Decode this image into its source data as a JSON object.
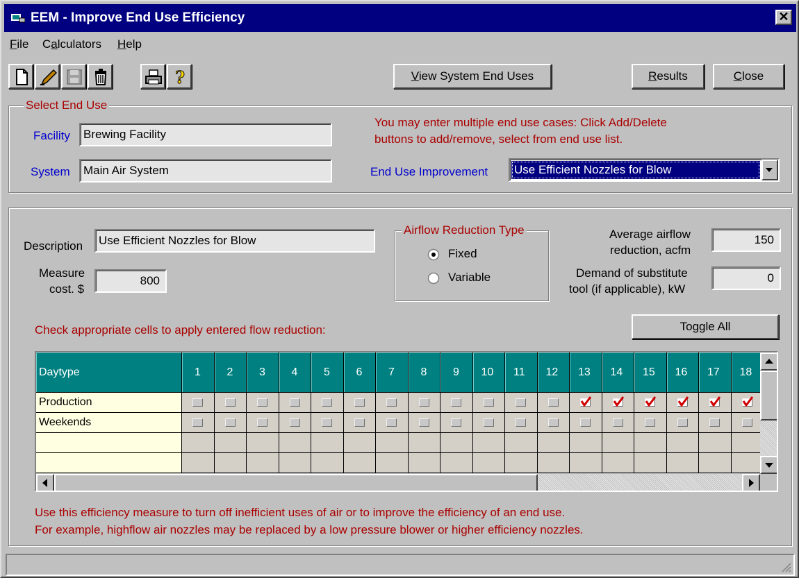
{
  "window": {
    "title": "EEM - Improve End Use Efficiency",
    "close_glyph": "✕"
  },
  "menu": [
    {
      "label": "File",
      "key": "F"
    },
    {
      "label": "Calculators",
      "key": "a"
    },
    {
      "label": "Help",
      "key": "H"
    }
  ],
  "toolbar": {
    "icons": [
      "new-icon",
      "edit-icon",
      "save-icon",
      "delete-icon",
      "print-icon",
      "help-icon"
    ]
  },
  "buttons": {
    "view_end_uses": "View System End Uses",
    "results": "Results",
    "close": "Close",
    "toggle_all": "Toggle All"
  },
  "select_end_use": {
    "legend": "Select End Use",
    "facility_label": "Facility",
    "facility_value": "Brewing Facility",
    "system_label": "System",
    "system_value": "Main Air System",
    "info_line1": "You may enter multiple end use cases: Click Add/Delete",
    "info_line2": "buttons to add/remove, select from end use list.",
    "improvement_label": "End Use Improvement",
    "improvement_value": "Use Efficient Nozzles for Blow"
  },
  "details": {
    "description_label": "Description",
    "description_value": "Use Efficient Nozzles for Blow",
    "measure_label_1": "Measure",
    "measure_label_2": "cost. $",
    "measure_value": "800",
    "airflow_legend": "Airflow Reduction Type",
    "fixed_label": "Fixed",
    "variable_label": "Variable",
    "selected_type": "Fixed",
    "avg_label_1": "Average airflow",
    "avg_label_2": "reduction, acfm",
    "avg_value": "150",
    "demand_label_1": "Demand of substitute",
    "demand_label_2": "tool (if applicable), kW",
    "demand_value": "0",
    "check_instruction": "Check appropriate cells to apply entered flow reduction:"
  },
  "grid": {
    "header_label": "Daytype",
    "hours": [
      "1",
      "2",
      "3",
      "4",
      "5",
      "6",
      "7",
      "8",
      "9",
      "10",
      "11",
      "12",
      "13",
      "14",
      "15",
      "16",
      "17",
      "18"
    ],
    "rows": [
      {
        "label": "Production",
        "checked": [
          13,
          14,
          15,
          16,
          17,
          18
        ]
      },
      {
        "label": "Weekends",
        "checked": []
      },
      {
        "label": "",
        "checked": null
      },
      {
        "label": "",
        "checked": null
      }
    ]
  },
  "footer": {
    "line1": "Use this efficiency measure to turn off inefficient uses of air or to improve the efficiency of an end use.",
    "line2": "For example, highflow air nozzles may be replaced by a low pressure blower or higher efficiency nozzles."
  },
  "colors": {
    "title_bar": "#000080",
    "grid_header": "#008080",
    "row_label_bg": "#ffffe1",
    "info_text": "#aa0000",
    "label_blue": "#0000cc",
    "check_red": "#d00000"
  }
}
